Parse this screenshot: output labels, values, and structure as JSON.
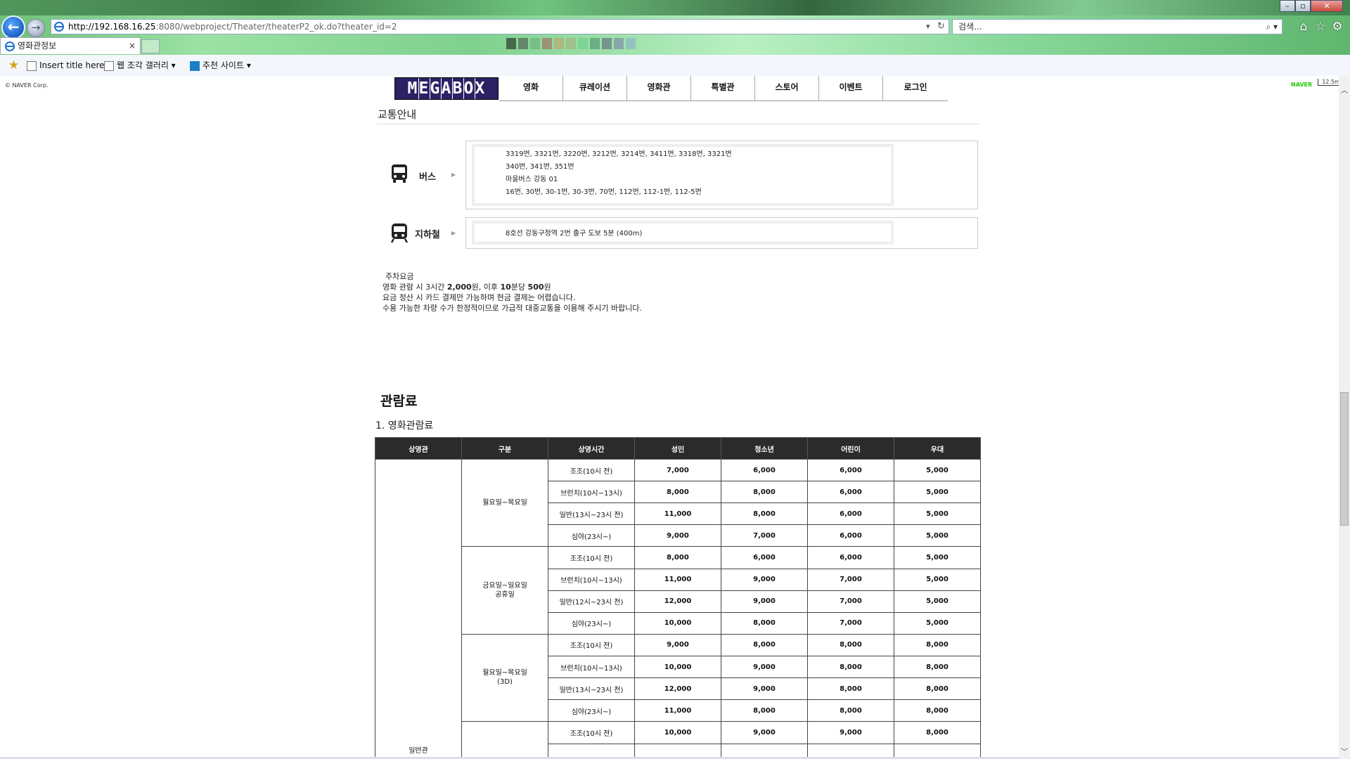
{
  "browser": {
    "url_host": "http://192.168.16.25",
    "url_rest": ":8080/webproject/Theater/theaterP2_ok.do?theater_id=2",
    "search_placeholder": "검색...",
    "tab_title": "영화관정보",
    "tab_close": "×",
    "favorites": [
      {
        "label": "Insert title here"
      },
      {
        "label": "웹 조각 갤러리 ▾"
      },
      {
        "label": "추천 사이트 ▾"
      }
    ]
  },
  "page": {
    "naver_corp": "© NAVER Corp.",
    "naver_logo": "NAVER",
    "scale": "12.5m",
    "logo_letters": [
      "M",
      "E",
      "G",
      "A",
      "B",
      "O",
      "X"
    ],
    "nav": [
      "영화",
      "큐레이션",
      "영화관",
      "특별관",
      "스토어",
      "이벤트",
      "로그인"
    ],
    "section_title": "교통안내",
    "bus": {
      "label": "버스",
      "lines": [
        "3319번, 3321번, 3220번, 3212번, 3214번, 3411번, 3318번, 3321번",
        "340번, 341번, 351번",
        "마을버스 강동 01",
        "16번, 30번, 30-1번, 30-3번, 70번, 112번, 112-1번, 112-5번"
      ]
    },
    "subway": {
      "label": "지하철",
      "lines": [
        "8호선 강동구청역 2번 출구 도보 5분 (400m)"
      ]
    },
    "parking": {
      "title": "주차요금",
      "line1_a": "영화 관람 시 3시간 ",
      "line1_b": "2,000",
      "line1_c": "원, 이후 ",
      "line1_d": "10",
      "line1_e": "분당 ",
      "line1_f": "500",
      "line1_g": "원",
      "line2": "요금 정산 시 카드 결제만 가능하며 현금 결제는 어렵습니다.",
      "line3": "수용 가능한 차량 수가 한정적이므로 가급적 대중교통을 이용해 주시기 바랍니다."
    },
    "fee_title": "관람료",
    "fee_subtitle": "1. 영화관람료"
  },
  "fee_table": {
    "headers": [
      "상영관",
      "구분",
      "상영시간",
      "성인",
      "청소년",
      "어린이",
      "우대"
    ],
    "hall": "일반관",
    "groups": [
      {
        "category": "월요일~목요일",
        "rows": [
          [
            "조조(10시 전)",
            "7,000",
            "6,000",
            "6,000",
            "5,000"
          ],
          [
            "브런치(10시~13시)",
            "8,000",
            "8,000",
            "6,000",
            "5,000"
          ],
          [
            "일반(13시~23시 전)",
            "11,000",
            "8,000",
            "6,000",
            "5,000"
          ],
          [
            "심야(23시~)",
            "9,000",
            "7,000",
            "6,000",
            "5,000"
          ]
        ]
      },
      {
        "category": "금요일~일요일\n공휴일",
        "rows": [
          [
            "조조(10시 전)",
            "8,000",
            "6,000",
            "6,000",
            "5,000"
          ],
          [
            "브런치(10시~13시)",
            "11,000",
            "9,000",
            "7,000",
            "5,000"
          ],
          [
            "일반(12시~23시 전)",
            "12,000",
            "9,000",
            "7,000",
            "5,000"
          ],
          [
            "심야(23시~)",
            "10,000",
            "8,000",
            "7,000",
            "5,000"
          ]
        ]
      },
      {
        "category": "월요일~목요일\n(3D)",
        "rows": [
          [
            "조조(10시 전)",
            "9,000",
            "8,000",
            "8,000",
            "8,000"
          ],
          [
            "브런치(10시~13시)",
            "10,000",
            "9,000",
            "8,000",
            "8,000"
          ],
          [
            "일반(13시~23시 전)",
            "12,000",
            "9,000",
            "8,000",
            "8,000"
          ],
          [
            "심야(23시~)",
            "11,000",
            "8,000",
            "8,000",
            "8,000"
          ]
        ]
      },
      {
        "category": "",
        "rows": [
          [
            "조조(10시 전)",
            "10,000",
            "9,000",
            "9,000",
            "8,000"
          ],
          [
            "",
            "",
            "",
            "",
            ""
          ]
        ]
      }
    ]
  }
}
